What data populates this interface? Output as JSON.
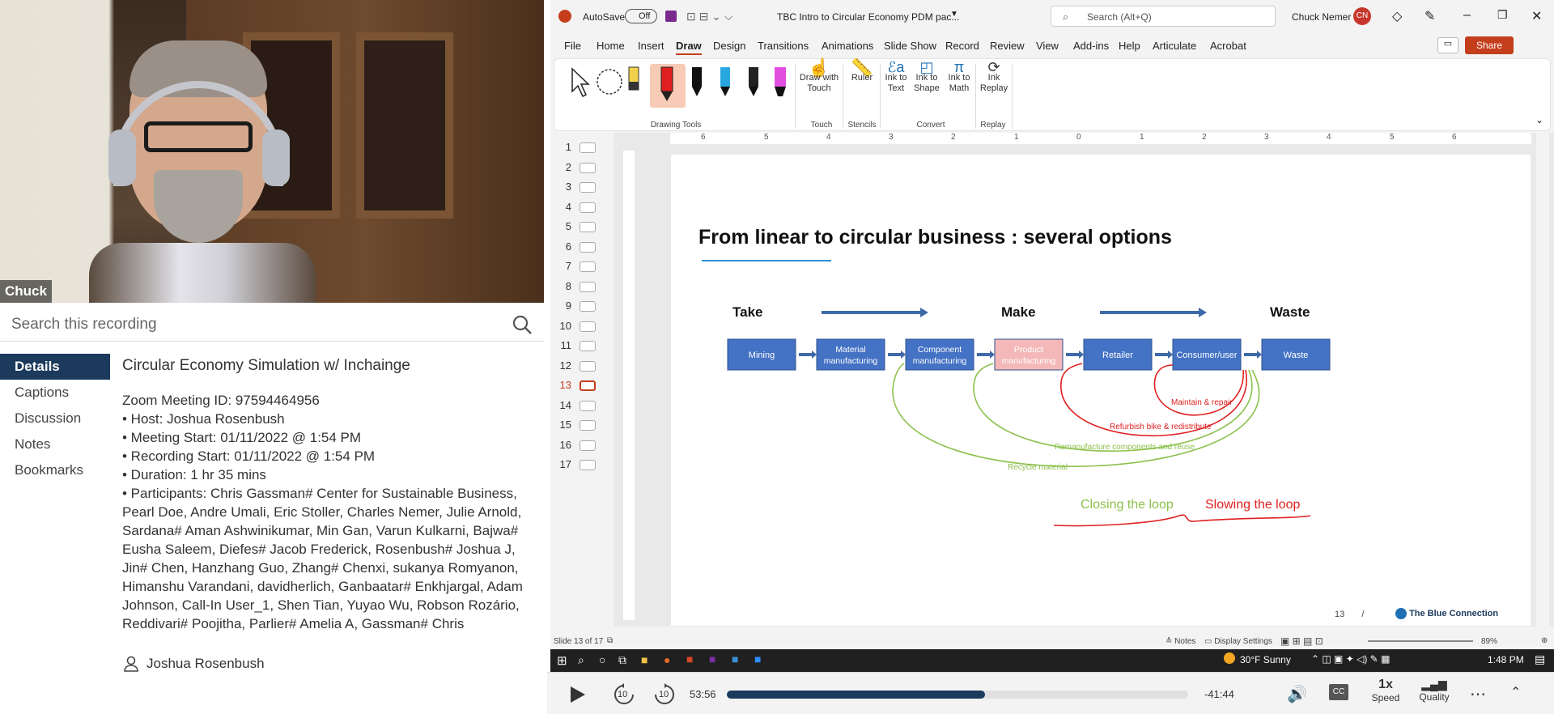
{
  "video": {
    "name_label": "Chuck"
  },
  "search": {
    "placeholder": "Search this recording"
  },
  "nav": {
    "items": [
      "Details",
      "Captions",
      "Discussion",
      "Notes",
      "Bookmarks"
    ]
  },
  "details": {
    "title": "Circular Economy Simulation w/ Inchainge",
    "lines": [
      "Zoom Meeting ID: 97594464956",
      "• Host: Joshua Rosenbush",
      "• Meeting Start: 01/11/2022 @ 1:54 PM",
      "• Recording Start: 01/11/2022 @ 1:54 PM",
      "• Duration: 1 hr 35 mins",
      "• Participants: Chris Gassman# Center for Sustainable Business, Pearl Doe, Andre Umali, Eric Stoller, Charles Nemer, Julie Arnold, Sardana# Aman Ashwinikumar, Min Gan, Varun Kulkarni, Bajwa# Eusha Saleem, Diefes# Jacob Frederick, Rosenbush# Joshua J, Jin# Chen, Hanzhang Guo, Zhang# Chenxi, sukanya Romyanon, Himanshu Varandani, davidherlich, Ganbaatar# Enkhjargal, Adam Johnson, Call-In User_1, Shen Tian, Yuyao Wu, Robson Rozário, Reddivari# Poojitha, Parlier# Amelia A, Gassman# Chris"
    ],
    "host_name": "Joshua Rosenbush"
  },
  "titlebar": {
    "autosave": "AutoSave",
    "toggle": "Off",
    "filename": "TBC  Intro to Circular Economy PDM pac...",
    "search": "Search (Alt+Q)",
    "user": "Chuck Nemer",
    "initials": "CN",
    "share": "Share"
  },
  "menu": [
    "File",
    "Home",
    "Insert",
    "Draw",
    "Design",
    "Transitions",
    "Animations",
    "Slide Show",
    "Record",
    "Review",
    "View",
    "Add-ins",
    "Help",
    "Articulate",
    "Acrobat"
  ],
  "ribbon": {
    "draw_touch": "Draw with Touch",
    "ruler": "Ruler",
    "ink_text": "Ink to Text",
    "ink_shape": "Ink to Shape",
    "ink_math": "Ink to Math",
    "ink_replay": "Ink Replay",
    "groups": [
      "Drawing Tools",
      "Touch",
      "Stencils",
      "Convert",
      "Replay"
    ]
  },
  "thumbs": [
    "1",
    "2",
    "3",
    "4",
    "5",
    "6",
    "7",
    "8",
    "9",
    "10",
    "11",
    "12",
    "13",
    "14",
    "15",
    "16",
    "17"
  ],
  "ruler": [
    "6",
    "5",
    "4",
    "3",
    "2",
    "1",
    "0",
    "1",
    "2",
    "3",
    "4",
    "5",
    "6"
  ],
  "slide": {
    "title": "From linear to circular business : several options",
    "stages": [
      "Take",
      "Make",
      "Waste"
    ],
    "boxes": [
      "Mining",
      "Material manufacturing",
      "Component manufacturing",
      "Product manufacturing",
      "Retailer",
      "Consumer/user",
      "Waste"
    ],
    "loops": [
      "Maintain & repair",
      "Refurbish bike & redistribute",
      "Remanufacture components and reuse",
      "Recycle material"
    ],
    "closing": "Closing the loop",
    "slowing": "Slowing the loop",
    "page": "13",
    "slash": "/",
    "brand": "The Blue Connection",
    "colors": {
      "box": "#4472c4",
      "green": "#8cc04b",
      "red": "#e02020",
      "pink": "#f4b8b8"
    }
  },
  "status": {
    "slide": "Slide 13 of 17",
    "notes": "Notes",
    "display": "Display Settings",
    "zoom": "89%"
  },
  "taskbar": {
    "weather": "30°F  Sunny",
    "time": "1:48 PM"
  },
  "player": {
    "elapsed": "53:56",
    "remaining": "-41:44",
    "progress": 0.56,
    "speed_value": "1x",
    "speed_label": "Speed",
    "quality_label": "Quality",
    "skip": "10"
  }
}
